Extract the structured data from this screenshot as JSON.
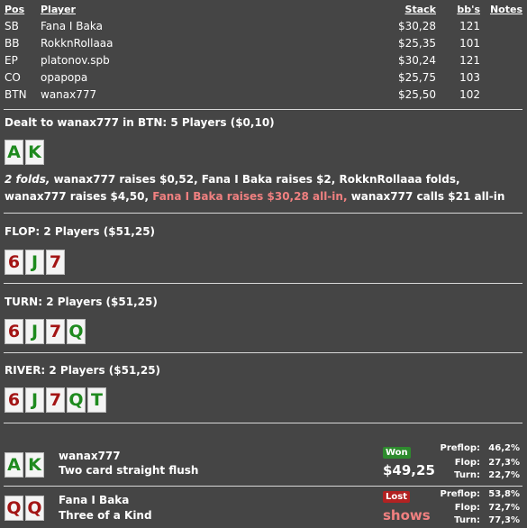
{
  "header": {
    "pos": "Pos",
    "player": "Player",
    "stack": "Stack",
    "bbs": "bb's",
    "notes": "Notes"
  },
  "players": [
    {
      "pos": "SB",
      "name": "Fana I Baka",
      "stack": "$30,28",
      "bbs": "121"
    },
    {
      "pos": "BB",
      "name": "RokknRollaaa",
      "stack": "$25,35",
      "bbs": "101"
    },
    {
      "pos": "EP",
      "name": "platonov.spb",
      "stack": "$30,24",
      "bbs": "121"
    },
    {
      "pos": "CO",
      "name": "opapopa",
      "stack": "$25,75",
      "bbs": "103"
    },
    {
      "pos": "BTN",
      "name": "wanax777",
      "stack": "$25,50",
      "bbs": "102"
    }
  ],
  "preflop": {
    "title": "Dealt to wanax777 in BTN: 5 Players ($0,10)",
    "cards": [
      {
        "rank": "A",
        "color": "green"
      },
      {
        "rank": "K",
        "color": "green"
      }
    ],
    "action_italic": "2 folds,",
    "action_1": " wanax777 raises $0,52, Fana I Baka raises $2, RokknRollaaa folds, wanax777 raises $4,50, ",
    "action_pink": "Fana I Baka raises $30,28 all-in,",
    "action_2": " wanax777 calls $21 all-in"
  },
  "flop": {
    "title": "FLOP: 2 Players ($51,25)",
    "cards": [
      {
        "rank": "6",
        "color": "red"
      },
      {
        "rank": "J",
        "color": "green"
      },
      {
        "rank": "7",
        "color": "red"
      }
    ]
  },
  "turn": {
    "title": "TURN: 2 Players ($51,25)",
    "cards": [
      {
        "rank": "6",
        "color": "red"
      },
      {
        "rank": "J",
        "color": "green"
      },
      {
        "rank": "7",
        "color": "red"
      },
      {
        "rank": "Q",
        "color": "green"
      }
    ]
  },
  "river": {
    "title": "RIVER: 2 Players ($51,25)",
    "cards": [
      {
        "rank": "6",
        "color": "red"
      },
      {
        "rank": "J",
        "color": "green"
      },
      {
        "rank": "7",
        "color": "red"
      },
      {
        "rank": "Q",
        "color": "green"
      },
      {
        "rank": "T",
        "color": "green"
      }
    ]
  },
  "showdown": [
    {
      "cards": [
        {
          "rank": "A",
          "color": "green"
        },
        {
          "rank": "K",
          "color": "green"
        }
      ],
      "name": "wanax777",
      "hand": "Two card straight flush",
      "badge": "Won",
      "amount": "$49,25",
      "equity": [
        {
          "label": "Preflop:",
          "value": "46,2%"
        },
        {
          "label": "Flop:",
          "value": "27,3%"
        },
        {
          "label": "Turn:",
          "value": "22,7%"
        }
      ]
    },
    {
      "cards": [
        {
          "rank": "Q",
          "color": "red"
        },
        {
          "rank": "Q",
          "color": "red"
        }
      ],
      "name": "Fana I Baka",
      "hand": "Three of a Kind",
      "badge": "Lost",
      "amount": "shows",
      "equity": [
        {
          "label": "Preflop:",
          "value": "53,8%"
        },
        {
          "label": "Flop:",
          "value": "72,7%"
        },
        {
          "label": "Turn:",
          "value": "77,3%"
        }
      ]
    }
  ],
  "colors": {
    "background": "#454545",
    "red_card": "#a31515",
    "green_card": "#1e8a1e",
    "pink": "#f08080",
    "won": "#2e8b2e",
    "lost": "#b22222"
  }
}
